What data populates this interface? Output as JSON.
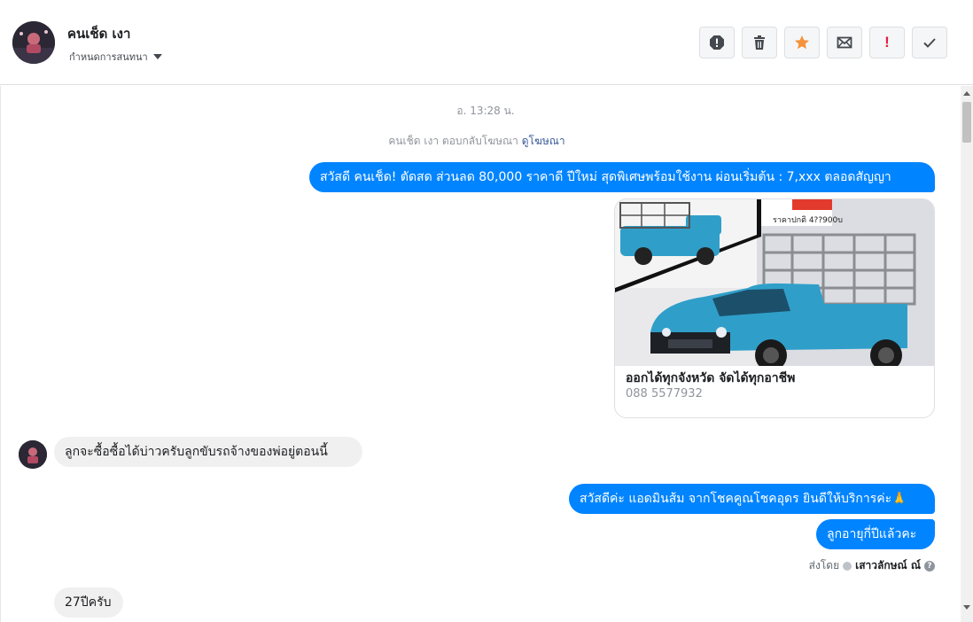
{
  "header": {
    "contact_name": "คนเช็ด เงา",
    "assign_label": "กำหนดการสนทนา"
  },
  "toolbar": {
    "icons": [
      "alert-icon",
      "trash-icon",
      "star-icon",
      "envelope-icon",
      "exclamation-icon",
      "check-icon"
    ],
    "exclamation_glyph": "!",
    "colors": {
      "star": "#f7923b",
      "exclamation": "#e41e3f",
      "icon": "#444950"
    }
  },
  "thread": {
    "timestamp": "อ. 13:28 น.",
    "reply_note": {
      "text": "คนเช็ด เงา ตอบกลับโฆษณา",
      "link": "ดูโฆษณา"
    },
    "messages": [
      {
        "from": "page",
        "text": "สวัสดี คนเช็ด! ตัดสด ส่วนลด 80,000 ราคาดี ปีใหม่ สุดพิเศษพร้อมใช้งาน ผ่อนเริ่มต้น :  7,xxx ตลอดสัญญา"
      },
      {
        "from": "contact",
        "text": "ลูกจะซื้อซื้อได้บ่าวครับลูกขับรถจ้างของพ่อยู่ตอนนี้"
      },
      {
        "from": "page",
        "text": "สวัสดีค่ะ แอดมินส้ม จากโชคคูณโชคอุดร ยินดีให้บริการค่ะ🙏"
      },
      {
        "from": "page",
        "text": "ลูกอายุกี่ปีแล้วคะ"
      },
      {
        "from": "contact",
        "text": "27ปีครับ"
      }
    ],
    "ad_card": {
      "image_text": "ราคาปกติ 4??900บ",
      "title": "ออกได้ทุกจังหวัด จัดได้ทุกอาชีพ",
      "subtitle": "088 5577932"
    },
    "sent_by": {
      "label": "ส่งโดย",
      "agent": "เสาวลักษณ์ ณ์",
      "help": "?"
    }
  },
  "colors": {
    "outgoing_bubble": "#0084ff",
    "incoming_bubble": "#f1f0f0",
    "car_body": "#2f9fc9"
  }
}
